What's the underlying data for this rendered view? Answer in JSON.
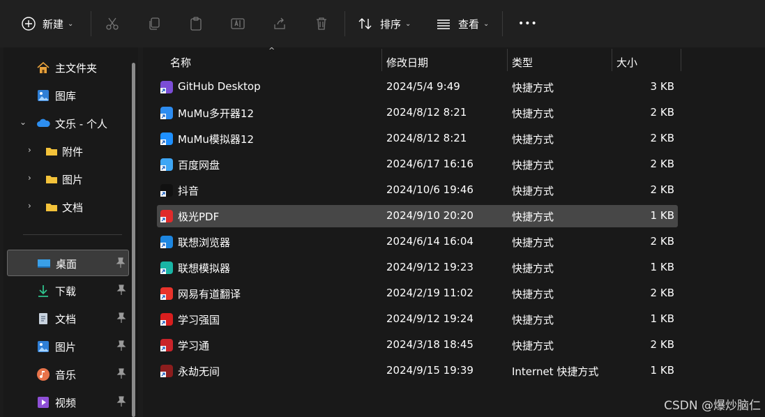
{
  "toolbar": {
    "new_label": "新建",
    "sort_label": "排序",
    "view_label": "查看",
    "more_label": "•••"
  },
  "sidebar": {
    "items": [
      {
        "label": "主文件夹",
        "icon": "home-icon"
      },
      {
        "label": "图库",
        "icon": "gallery-icon"
      },
      {
        "label": "文乐 - 个人",
        "icon": "onedrive-cloud-icon"
      },
      {
        "label": "附件",
        "icon": "folder-icon"
      },
      {
        "label": "图片",
        "icon": "folder-icon"
      },
      {
        "label": "文档",
        "icon": "folder-icon"
      },
      {
        "label": "桌面",
        "icon": "desktop-icon"
      },
      {
        "label": "下载",
        "icon": "download-icon"
      },
      {
        "label": "文档",
        "icon": "document-icon"
      },
      {
        "label": "图片",
        "icon": "pictures-icon"
      },
      {
        "label": "音乐",
        "icon": "music-icon"
      },
      {
        "label": "视频",
        "icon": "video-icon"
      }
    ]
  },
  "columns": {
    "name": "名称",
    "date": "修改日期",
    "type": "类型",
    "size": "大小"
  },
  "files": [
    {
      "name": "GitHub Desktop",
      "date": "2024/5/4 9:49",
      "type": "快捷方式",
      "size": "3 KB",
      "color": "#7b4dd6"
    },
    {
      "name": "MuMu多开器12",
      "date": "2024/8/12 8:21",
      "type": "快捷方式",
      "size": "2 KB",
      "color": "#2d8cf0"
    },
    {
      "name": "MuMu模拟器12",
      "date": "2024/8/12 8:21",
      "type": "快捷方式",
      "size": "2 KB",
      "color": "#1e90ff"
    },
    {
      "name": "百度网盘",
      "date": "2024/6/17 16:16",
      "type": "快捷方式",
      "size": "2 KB",
      "color": "#3ea6f5"
    },
    {
      "name": "抖音",
      "date": "2024/10/6 19:46",
      "type": "快捷方式",
      "size": "2 KB",
      "color": "#111111"
    },
    {
      "name": "极光PDF",
      "date": "2024/9/10 20:20",
      "type": "快捷方式",
      "size": "1 KB",
      "color": "#e02b2b"
    },
    {
      "name": "联想浏览器",
      "date": "2024/6/14 16:04",
      "type": "快捷方式",
      "size": "2 KB",
      "color": "#1d86e0"
    },
    {
      "name": "联想模拟器",
      "date": "2024/9/12 19:23",
      "type": "快捷方式",
      "size": "1 KB",
      "color": "#19b5a5"
    },
    {
      "name": "网易有道翻译",
      "date": "2024/2/19 11:02",
      "type": "快捷方式",
      "size": "2 KB",
      "color": "#e8332b"
    },
    {
      "name": "学习强国",
      "date": "2024/9/12 19:24",
      "type": "快捷方式",
      "size": "1 KB",
      "color": "#d81e1e"
    },
    {
      "name": "学习通",
      "date": "2024/3/18 18:45",
      "type": "快捷方式",
      "size": "2 KB",
      "color": "#c9242a"
    },
    {
      "name": "永劫无间",
      "date": "2024/9/15 19:39",
      "type": "Internet 快捷方式",
      "size": "1 KB",
      "color": "#8c1d1d"
    }
  ],
  "watermark": "CSDN @爆炒脑仁"
}
